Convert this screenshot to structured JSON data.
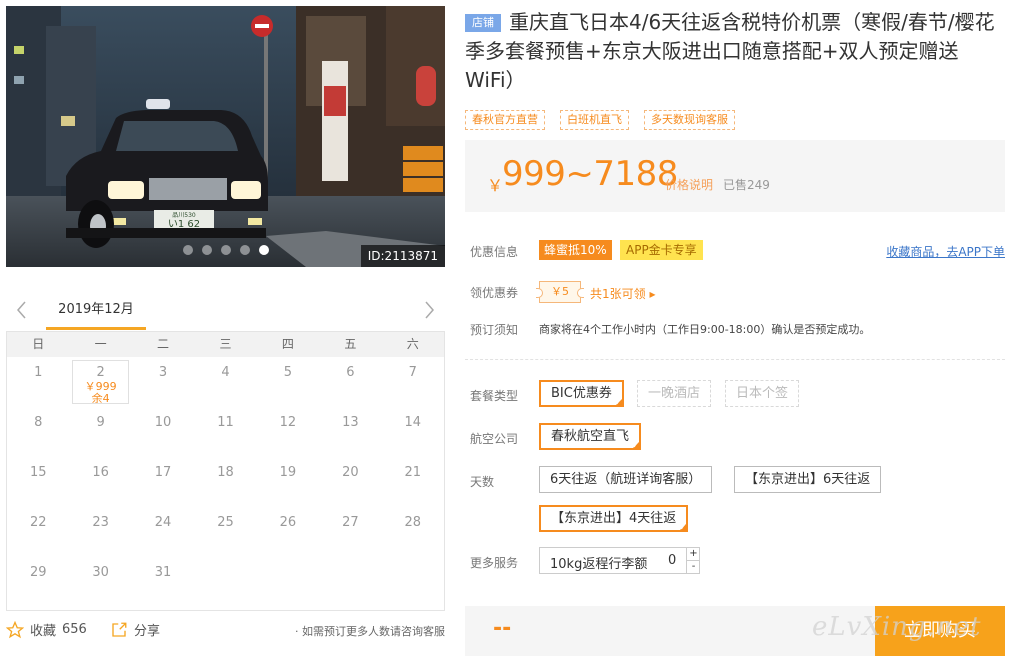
{
  "gallery": {
    "image_id": "ID:2113871",
    "plate_top": "品川530",
    "plate_bottom": "い1 62",
    "slide_count": 5,
    "active_slide": 5
  },
  "calendar": {
    "month_label": "2019年12月",
    "weekdays": [
      "日",
      "一",
      "二",
      "三",
      "四",
      "五",
      "六"
    ],
    "days": [
      "1",
      "2",
      "3",
      "4",
      "5",
      "6",
      "7",
      "8",
      "9",
      "10",
      "11",
      "12",
      "13",
      "14",
      "15",
      "16",
      "17",
      "18",
      "19",
      "20",
      "21",
      "22",
      "23",
      "24",
      "25",
      "26",
      "27",
      "28",
      "29",
      "30",
      "31"
    ],
    "selected_day": {
      "day": "2",
      "price": "￥999",
      "stock": "余4"
    }
  },
  "footer": {
    "favorite_label": "收藏",
    "favorite_count": "656",
    "share_label": "分享",
    "consult_note": "· 如需预订更多人数请咨询客服"
  },
  "product": {
    "shop_tag": "店铺",
    "title": "重庆直飞日本4/6天往返含税特价机票（寒假/春节/樱花季多套餐预售+东京大阪进出口随意搭配+双人预定赠送WiFi）",
    "tags": [
      "春秋官方直营",
      "白班机直飞",
      "多天数现询客服"
    ]
  },
  "price": {
    "currency": "￥",
    "range": "999~7188",
    "explain_label": "价格说明",
    "sold": "已售249"
  },
  "info": {
    "promo_label": "优惠信息",
    "promo_badge": "蜂蜜抵10%",
    "vip_badge": "APP金卡专享",
    "app_link": "收藏商品，去APP下单",
    "coupon_label": "领优惠券",
    "coupon_value": "￥5",
    "coupon_link": "共1张可领 ▸",
    "notice_label": "预订须知",
    "notice_text": "商家将在4个工作小时内（工作日9:00-18:00）确认是否预定成功。"
  },
  "options": {
    "package_label": "套餐类型",
    "packages": [
      "BIC优惠券",
      "一晚酒店",
      "日本个签"
    ],
    "airline_label": "航空公司",
    "airline": "春秋航空直飞",
    "days_label": "天数",
    "days": [
      "6天往返（航班详询客服）",
      "【东京进出】6天往返",
      "【东京进出】4天往返"
    ],
    "services_label": "更多服务",
    "service_item": "10kg返程行李额",
    "service_qty": "0",
    "plus": "+",
    "minus": "-"
  },
  "buy": {
    "total": "--",
    "button": "立即购买"
  },
  "watermark": "eLvXing.net",
  "colors": {
    "accent": "#f68b1e",
    "buy_button": "#f7a21b",
    "link": "#3b76c9",
    "shop_tag": "#7aa7e8",
    "vip_badge": "#ffe34f"
  }
}
